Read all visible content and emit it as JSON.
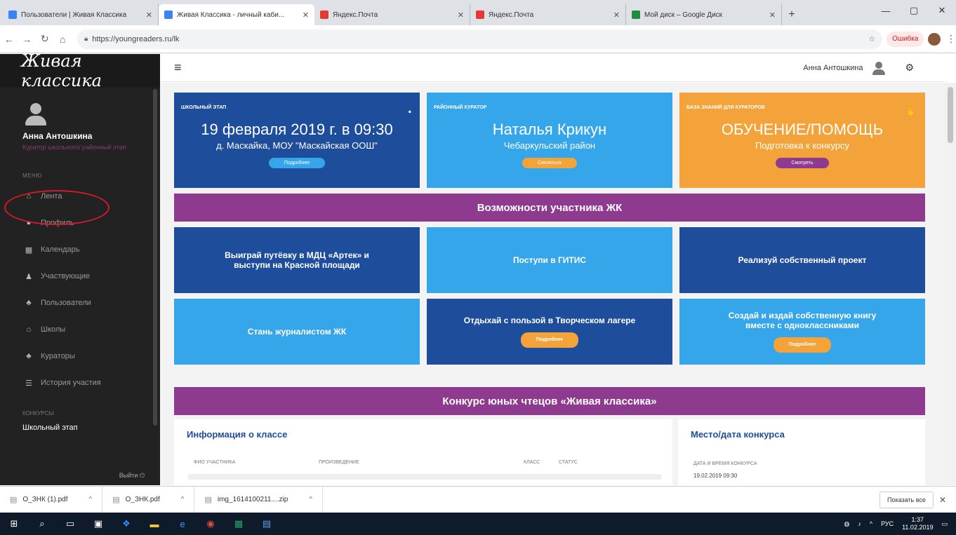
{
  "browser": {
    "tabs": [
      {
        "title": "Пользователи | Живая Классика",
        "favicon_color": "#3b82f6",
        "active": false
      },
      {
        "title": "Живая Классика - личный каби...",
        "favicon_color": "#3b82f6",
        "active": true
      },
      {
        "title": "Яндекс.Почта",
        "favicon_color": "#e53935",
        "active": false
      },
      {
        "title": "Яндекс.Почта",
        "favicon_color": "#e53935",
        "active": false
      },
      {
        "title": "Мой диск – Google Диск",
        "favicon_color": "#1e8e3e",
        "active": false
      }
    ],
    "url": "https://youngreaders.ru/lk",
    "error_label": "Ошибка"
  },
  "sidebar": {
    "logo": "Живая классика",
    "user_name": "Анна Антошкина",
    "user_role": "Куратор школьного/ районный этап",
    "menu_label": "МЕНЮ",
    "items": [
      {
        "label": "Лента",
        "icon": "home-icon",
        "glyph": "⌂"
      },
      {
        "label": "Профиль",
        "icon": "user-icon",
        "glyph": "●"
      },
      {
        "label": "Календарь",
        "icon": "calendar-icon",
        "glyph": "▦"
      },
      {
        "label": "Участвующие",
        "icon": "participants-icon",
        "glyph": "♟"
      },
      {
        "label": "Пользователи",
        "icon": "users-icon",
        "glyph": "♣"
      },
      {
        "label": "Школы",
        "icon": "school-icon",
        "glyph": "⌂"
      },
      {
        "label": "Кураторы",
        "icon": "curators-icon",
        "glyph": "♣"
      },
      {
        "label": "История участия",
        "icon": "history-icon",
        "glyph": "☰"
      }
    ],
    "contests_label": "КОНКУРСЫ",
    "school_stage": "Школьный этап",
    "logout": "Выйти ⏻"
  },
  "topbar": {
    "user_name": "Анна Антошкина"
  },
  "cards": [
    {
      "label": "Школьный этап",
      "big": "19 февраля 2019 г. в 09:30",
      "sub": "д. Маскайка, МОУ \"Маскайская ООШ\"",
      "button": "Подробнее",
      "bg": "#1e4e9b",
      "btn_bg": "#35a6ea"
    },
    {
      "label": "Районный куратор",
      "big": "Наталья Крикун",
      "sub": "Чебаркульский район",
      "button": "Связаться",
      "bg": "#35a6ea",
      "btn_bg": "#f3a33a"
    },
    {
      "label": "База знаний для кураторов",
      "big": "ОБУЧЕНИЕ/ПОМОЩЬ",
      "sub": "Подготовка к конкурсу",
      "button": "Смотреть",
      "bg": "#f3a33a",
      "btn_bg": "#8d3a8f"
    }
  ],
  "banner1": "Возможности участника ЖК",
  "features": [
    {
      "text": "Выиграй путёвку в МДЦ «Артек» и выступи на Красной площади",
      "bg": "#1e4e9b",
      "button": ""
    },
    {
      "text": "Поступи в ГИТИС",
      "bg": "#35a6ea",
      "button": ""
    },
    {
      "text": "Реализуй собственный проект",
      "bg": "#1e4e9b",
      "button": ""
    },
    {
      "text": "Стань журналистом ЖК",
      "bg": "#35a6ea",
      "button": ""
    },
    {
      "text": "Отдыхай с пользой в Творческом лагере",
      "bg": "#1e4e9b",
      "button": "Подробнее"
    },
    {
      "text": "Создай и издай собственную книгу вместе с одноклассниками",
      "bg": "#35a6ea",
      "button": "Подробнее"
    }
  ],
  "banner2": "Конкурс юных чтецов «Живая классика»",
  "class_panel": {
    "title": "Информация о классе",
    "columns": [
      "ФИО участника",
      "Произведение",
      "Класс",
      "Статус"
    ]
  },
  "place_panel": {
    "title": "Место/дата конкурса",
    "label": "Дата и время конкурса",
    "value": "19.02.2019 09:30"
  },
  "downloads": {
    "items": [
      "О_ЗНК (1).pdf",
      "О_ЗНК.pdf",
      "img_1614100211....zip"
    ],
    "show_all": "Показать все"
  },
  "taskbar": {
    "lang": "РУС",
    "time": "1:37",
    "date": "11.02.2019"
  }
}
